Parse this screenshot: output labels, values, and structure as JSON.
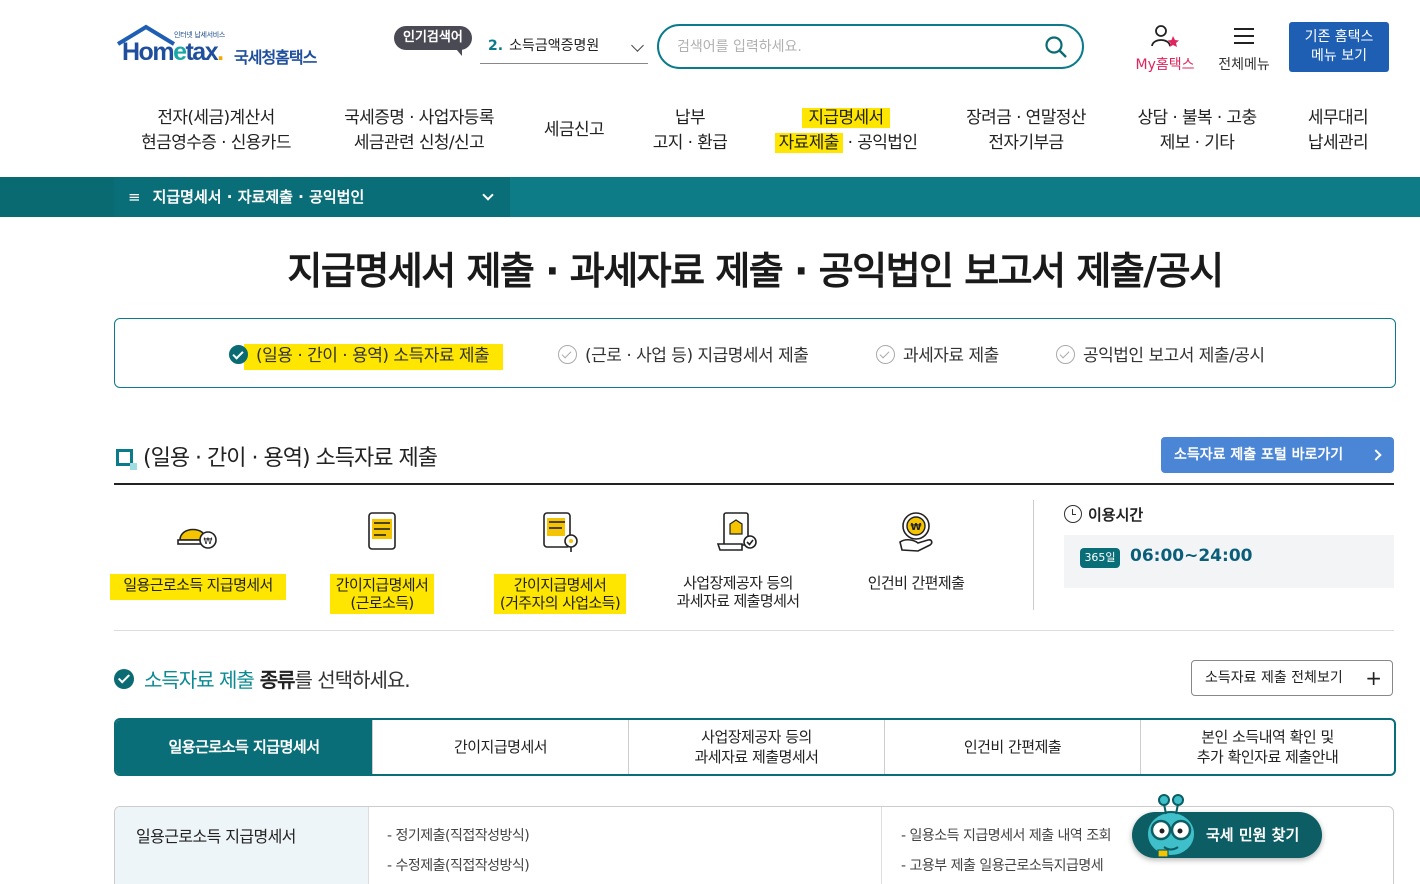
{
  "header": {
    "logo_sub": "인터넷 납세서비스",
    "logo_word": "Hometax.",
    "logo_kr": "국세청홈택스",
    "popular_badge": "인기검색어",
    "popular_num": "2.",
    "popular_term": "소득금액증명원",
    "search_placeholder": "검색어를 입력하세요.",
    "my_label": "My홈택스",
    "all_menu_label": "전체메뉴",
    "old_menu_line1": "기존 홈택스",
    "old_menu_line2": "메뉴 보기"
  },
  "gnb": [
    {
      "l1": "전자(세금)계산서",
      "l2": "현금영수증 · 신용카드"
    },
    {
      "l1": "국세증명 · 사업자등록",
      "l2": "세금관련 신청/신고"
    },
    {
      "l1": "세금신고",
      "l2": ""
    },
    {
      "l1": "납부",
      "l2": "고지 · 환급"
    },
    {
      "l1": "지급명세서",
      "l2a": "자료제출",
      "l2b": " · 공익법인"
    },
    {
      "l1": "장려금 · 연말정산",
      "l2": "전자기부금"
    },
    {
      "l1": "상담 · 불복 · 고충",
      "l2": "제보 · 기타"
    },
    {
      "l1": "세무대리",
      "l2": "납세관리"
    }
  ],
  "breadcrumb": {
    "current": "지급명세서 · 자료제출 · 공익법인"
  },
  "page_title": "지급명세서 제출 · 과세자료 제출 · 공익법인 보고서 제출/공시",
  "tabs": [
    {
      "label": "(일용 · 간이 · 용역) 소득자료 제출",
      "active": true
    },
    {
      "label": "(근로 · 사업 등) 지급명세서 제출",
      "active": false
    },
    {
      "label": "과세자료 제출",
      "active": false
    },
    {
      "label": "공익법인 보고서 제출/공시",
      "active": false
    }
  ],
  "section": {
    "title": "(일용 · 간이 · 용역) 소득자료 제출",
    "portal_button": "소득자료 제출 포털 바로가기"
  },
  "cards": [
    {
      "icon": "helmet-coin-icon",
      "line1": "일용근로소득 지급명세서",
      "line2": ""
    },
    {
      "icon": "document-list-icon",
      "line1": "간이지급명세서",
      "line2": "(근로소득)"
    },
    {
      "icon": "document-pin-icon",
      "line1": "간이지급명세서",
      "line2": "(거주자의 사업소득)"
    },
    {
      "icon": "document-check-icon",
      "line1": "사업장제공자 등의",
      "line2": "과세자료 제출명세서"
    },
    {
      "icon": "hand-coin-icon",
      "line1": "인건비 간편제출",
      "line2": ""
    }
  ],
  "hours": {
    "title": "이용시간",
    "badge": "365일",
    "time": "06:00~24:00"
  },
  "select_heading": {
    "accent": "소득자료 제출",
    "bold": " 종류",
    "rest": "를 선택하세요."
  },
  "view_all": "소득자료 제출 전체보기",
  "kind_tabs": [
    {
      "l1": "일용근로소득 지급명세서",
      "l2": ""
    },
    {
      "l1": "간이지급명세서",
      "l2": ""
    },
    {
      "l1": "사업장제공자 등의",
      "l2": "과세자료 제출명세서"
    },
    {
      "l1": "인건비 간편제출",
      "l2": ""
    },
    {
      "l1": "본인 소득내역 확인 및",
      "l2": "추가 확인자료 제출안내"
    }
  ],
  "detail": {
    "title": "일용근로소득 지급명세서",
    "left_items": [
      "정기제출(직접작성방식)",
      "수정제출(직접작성방식)"
    ],
    "right_items": [
      "일용소득 지급명세서 제출 내역 조회",
      "고용부 제출 일용근로소득지급명세"
    ]
  },
  "float_button": "국세 민원 찾기",
  "colors": {
    "primary": "#0a6e78",
    "highlight": "#ffe600",
    "blue_button": "#4a85d6"
  }
}
